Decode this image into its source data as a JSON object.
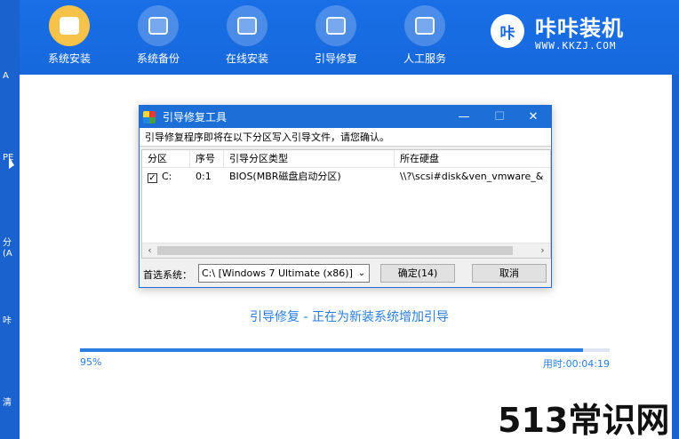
{
  "desktop_strip": {
    "fragments": [
      "A",
      "PE",
      "分",
      "(A",
      "咔",
      "清"
    ]
  },
  "nav": {
    "items": [
      {
        "label": "系统安装",
        "icon": "install-system-icon",
        "active": true
      },
      {
        "label": "系统备份",
        "icon": "backup-icon",
        "active": false
      },
      {
        "label": "在线安装",
        "icon": "download-icon",
        "active": false
      },
      {
        "label": "引导修复",
        "icon": "toolbox-icon",
        "active": false
      },
      {
        "label": "人工服务",
        "icon": "chat-icon",
        "active": false
      }
    ]
  },
  "brand": {
    "logo_text": "咔",
    "name": "咔咔装机",
    "url": "WWW.KKZJ.COM"
  },
  "dialog": {
    "title": "引导修复工具",
    "message": "引导修复程序即将在以下分区写入引导文件，请您确认。",
    "columns": [
      "分区",
      "序号",
      "引导分区类型",
      "所在硬盘"
    ],
    "rows": [
      {
        "checked": true,
        "partition": "C:",
        "index": "0:1",
        "type": "BIOS(MBR磁盘启动分区)",
        "disk": "\\\\?\\scsi#disk&ven_vmware_&"
      }
    ],
    "preferred_label": "首选系统：",
    "preferred_value": "C:\\ [Windows 7 Ultimate (x86)]",
    "confirm_label": "确定(14)",
    "cancel_label": "取消"
  },
  "status": {
    "text": "引导修复 - 正在为新装系统增加引导",
    "percent_text": "95%",
    "progress": 0.95,
    "elapsed": "用时:00:04:19"
  },
  "watermark": "513常识网",
  "colors": {
    "accent": "#1668dc",
    "active_icon": "#f7c24a",
    "progress": "#2a7de1"
  }
}
